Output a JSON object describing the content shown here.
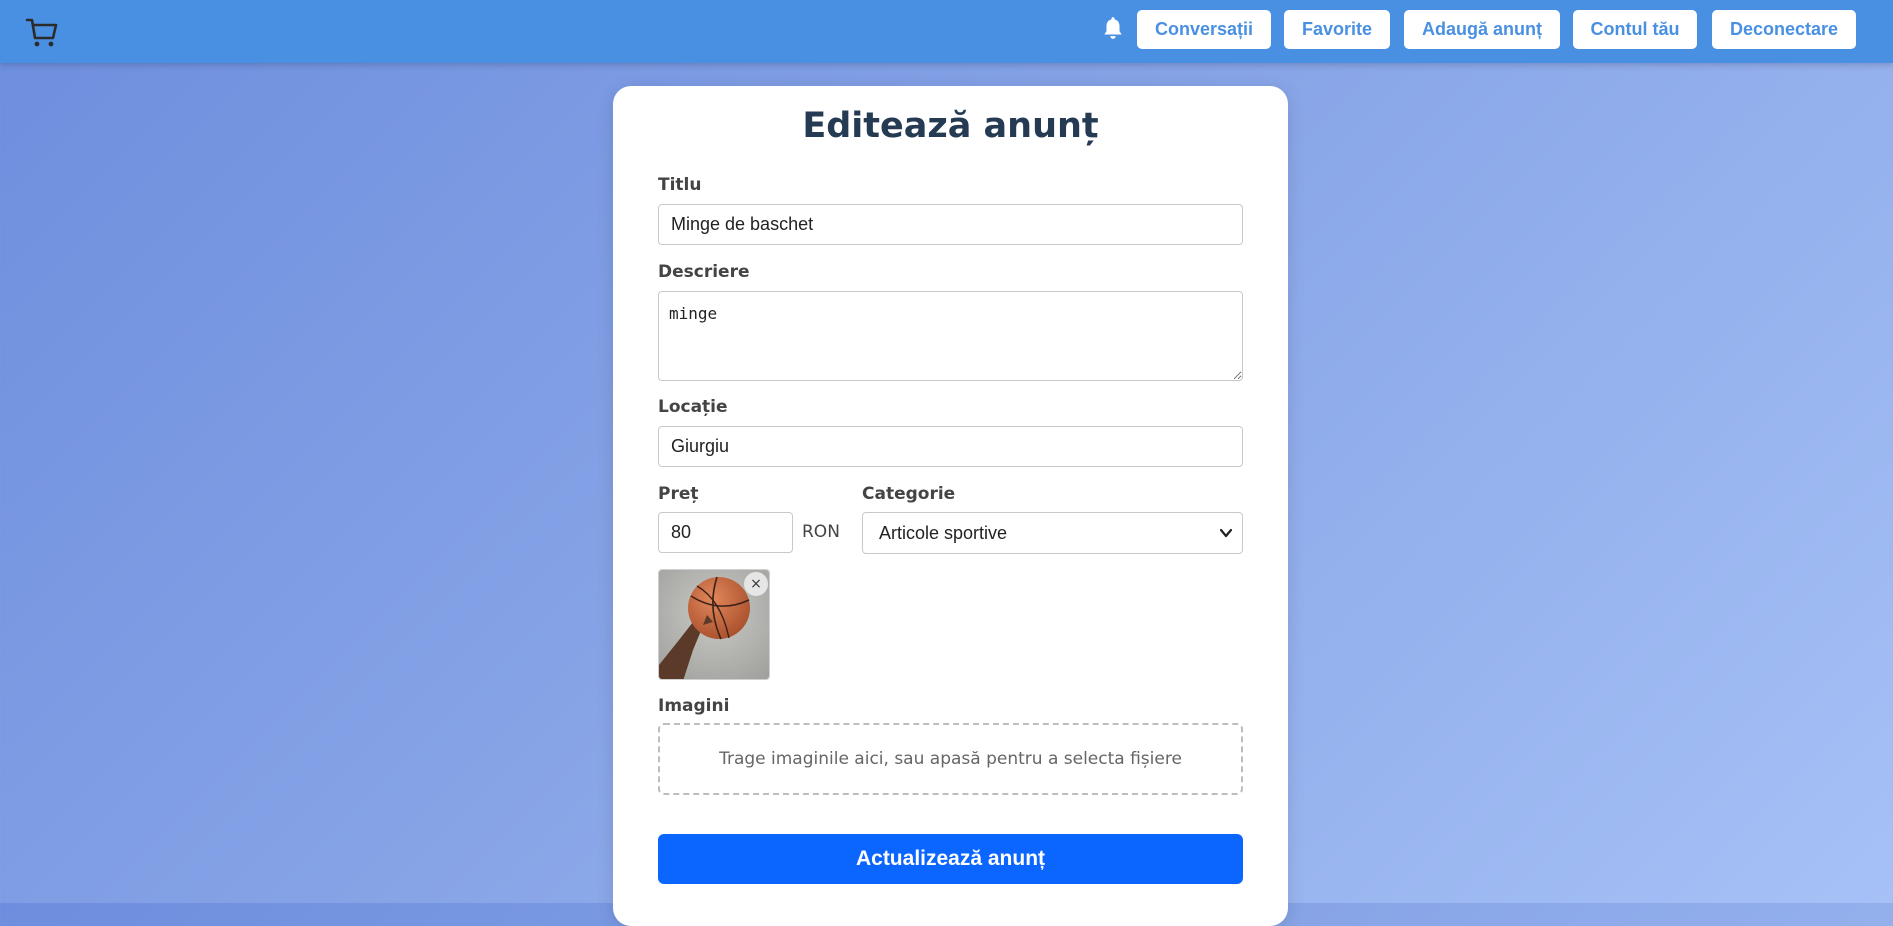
{
  "header": {
    "logo_icon": "cart-icon",
    "notification_icon": "bell-icon",
    "nav": [
      {
        "label": "Conversații"
      },
      {
        "label": "Favorite"
      },
      {
        "label": "Adaugă anunț"
      },
      {
        "label": "Contul tău"
      },
      {
        "label": "Deconectare"
      }
    ],
    "bar_color": "#4a90e2"
  },
  "form": {
    "title": "Editează anunț",
    "titlu": {
      "label": "Titlu",
      "value": "Minge de baschet"
    },
    "descriere": {
      "label": "Descriere",
      "value": "minge"
    },
    "locatie": {
      "label": "Locație",
      "value": "Giurgiu"
    },
    "pret": {
      "label": "Preț",
      "value": "80",
      "currency": "RON"
    },
    "categorie": {
      "label": "Categorie",
      "selected": "Articole sportive"
    },
    "images": {
      "label": "Imagini",
      "remove_symbol": "×",
      "dropzone_text": "Trage imaginile aici, sau apasă pentru a selecta fișiere"
    },
    "submit_label": "Actualizează anunț",
    "accent_color": "#0b66ff"
  }
}
